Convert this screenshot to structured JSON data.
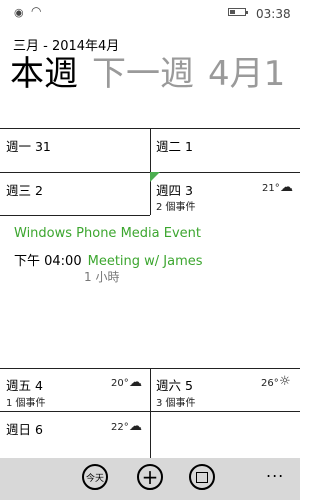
{
  "status": {
    "time": "03:38"
  },
  "header": {
    "month": "三月 - 2014年4月",
    "tabs": {
      "current": "本週",
      "next": "下一週",
      "partial": "4月1"
    }
  },
  "week": {
    "mon": {
      "label": "週一 31"
    },
    "tue": {
      "label": "週二 1"
    },
    "wed": {
      "label": "週三 2"
    },
    "thu": {
      "label": "週四 3",
      "temp": "21°",
      "events": "2 個事件"
    },
    "fri": {
      "label": "週五 4",
      "temp": "20°",
      "events": "1 個事件"
    },
    "sat": {
      "label": "週六 5",
      "temp": "26°",
      "events": "3 個事件"
    },
    "sun": {
      "label": "週日 6",
      "temp": "22°"
    }
  },
  "event": {
    "title": "Windows Phone Media Event",
    "time": "下午 04:00",
    "name": "Meeting w/ James",
    "duration": "1 小時"
  },
  "appbar": {
    "today": "今天",
    "more": "..."
  },
  "colors": {
    "accent": "#3ca62f"
  },
  "icons": {
    "rain": "rain-cloud-icon",
    "cloud": "cloud-icon",
    "sun": "sun-icon"
  }
}
